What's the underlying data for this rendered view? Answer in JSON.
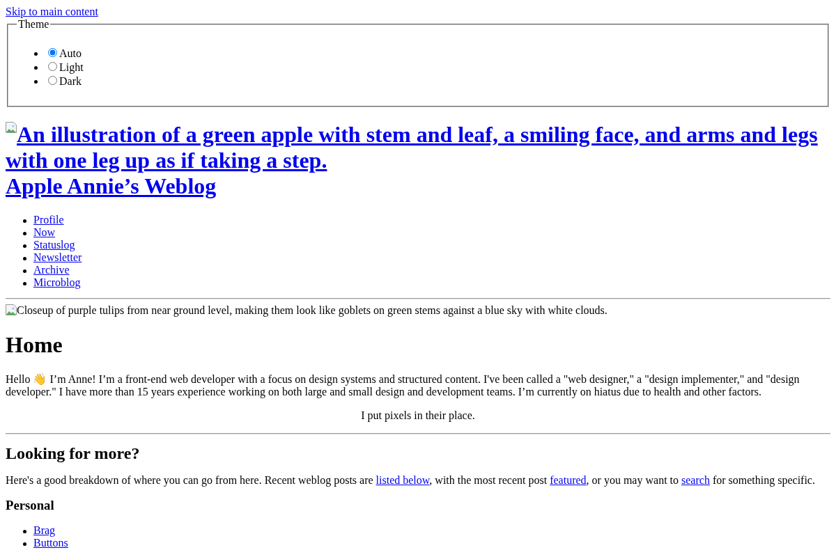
{
  "skip_link": "Skip to main content",
  "theme_picker": {
    "legend": "Theme",
    "options": [
      {
        "label": "Auto",
        "selected": true
      },
      {
        "label": "Light",
        "selected": false
      },
      {
        "label": "Dark",
        "selected": false
      }
    ]
  },
  "header": {
    "logo_alt": "An illustration of a green apple with stem and leaf, a smiling face, and arms and legs with one leg up as if taking a step.",
    "site_title": "Apple Annie’s Weblog"
  },
  "nav": [
    "Profile",
    "Now",
    "Statuslog",
    "Newsletter",
    "Archive",
    "Microblog"
  ],
  "banner_alt": "Closeup of purple tulips from near ground level, making them look like goblets on green stems against a blue sky with white clouds.",
  "main": {
    "heading": "Home",
    "intro": {
      "before": "Hello",
      "emoji": "👋",
      "after": "I’m Anne! I’m a front-end web developer with a focus on design systems and structured content. I've been called a \"web designer,\" a \"design implementer,\" and \"design developer.\" I have more than 15 years experience working on both large and small design and development teams. I’m currently on hiatus due to health and other factors."
    },
    "tagline": "I put pixels in their place."
  },
  "more": {
    "heading": "Looking for more?",
    "text": [
      {
        "kind": "text",
        "text": "Here's a good breakdown of where you can go from here. Recent weblog posts are "
      },
      {
        "kind": "link",
        "text": "listed below"
      },
      {
        "kind": "text",
        "text": ", with the most recent post "
      },
      {
        "kind": "link",
        "text": "featured"
      },
      {
        "kind": "text",
        "text": ", or you may want to "
      },
      {
        "kind": "link",
        "text": "search"
      },
      {
        "kind": "text",
        "text": " for something specific."
      }
    ],
    "sections": [
      {
        "heading": "Personal",
        "links": [
          "Brag",
          "Buttons"
        ]
      }
    ]
  }
}
